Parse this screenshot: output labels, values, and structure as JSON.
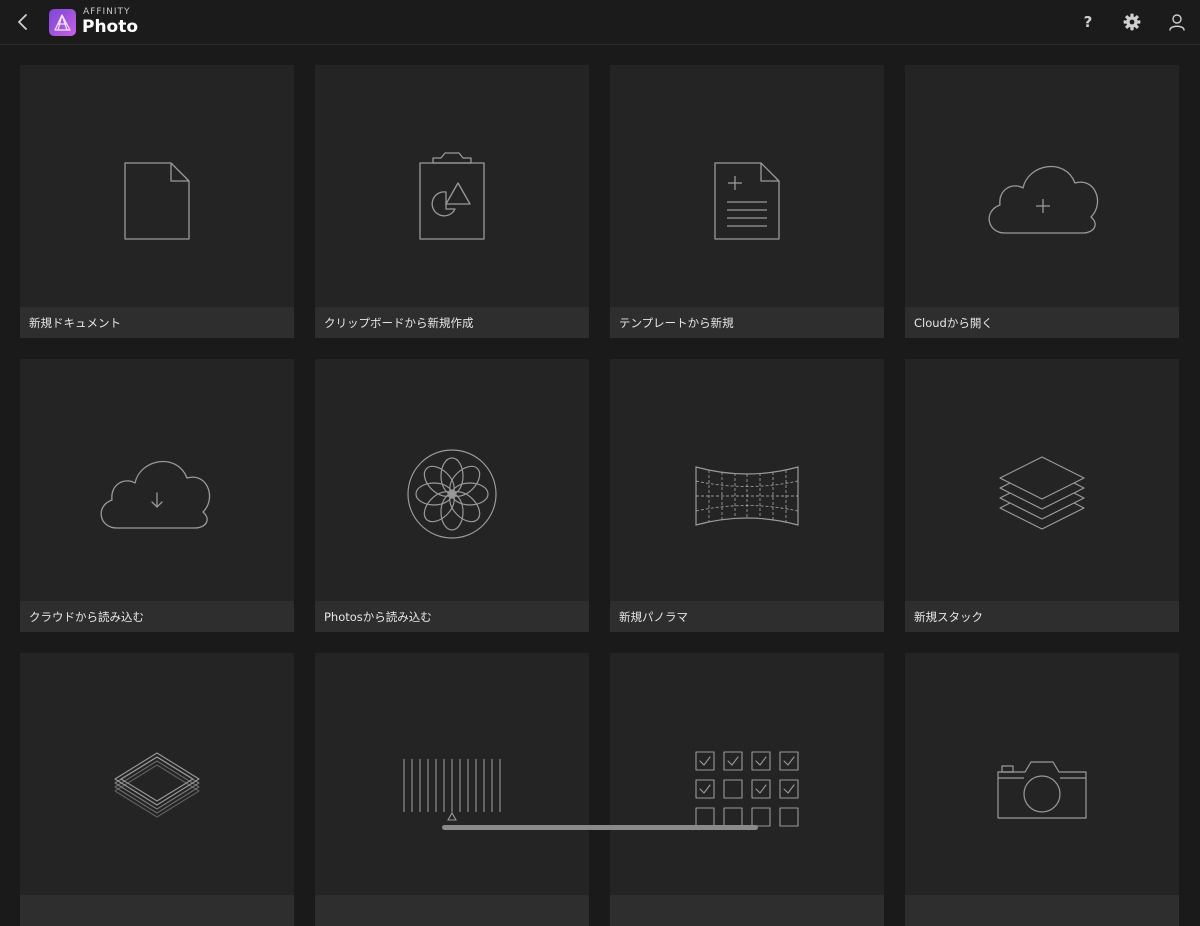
{
  "header": {
    "brand_top": "AFFINITY",
    "brand_main": "Photo",
    "help_label": "?",
    "back_icon": "chevron-left-icon",
    "settings_icon": "gear-icon",
    "account_icon": "user-icon",
    "logo_colors": [
      "#8a4ddb",
      "#c25fe0"
    ]
  },
  "tiles": [
    {
      "label": "新規ドキュメント",
      "icon": "new-document-icon"
    },
    {
      "label": "クリップボードから新規作成",
      "icon": "clipboard-icon"
    },
    {
      "label": "テンプレートから新規",
      "icon": "template-icon"
    },
    {
      "label": "Cloudから開く",
      "icon": "cloud-plus-icon"
    },
    {
      "label": "クラウドから読み込む",
      "icon": "cloud-download-icon"
    },
    {
      "label": "Photosから読み込む",
      "icon": "photos-flower-icon"
    },
    {
      "label": "新規パノラマ",
      "icon": "panorama-icon"
    },
    {
      "label": "新規スタック",
      "icon": "stack-icon"
    },
    {
      "label": "",
      "icon": "hdr-layers-icon"
    },
    {
      "label": "",
      "icon": "focus-merge-icon"
    },
    {
      "label": "",
      "icon": "batch-checkbox-icon"
    },
    {
      "label": "",
      "icon": "camera-icon"
    }
  ]
}
